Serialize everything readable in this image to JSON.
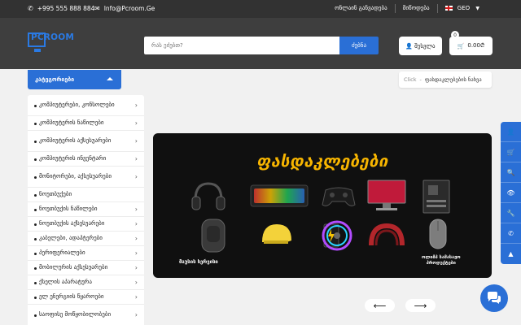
{
  "topbar": {
    "phone": "+995 555 888 884",
    "email": "Info@Pcroom.Ge",
    "links": [
      "ონლაინ განვადება",
      "მიწოდება"
    ],
    "language": "GEO"
  },
  "header": {
    "logo": "PCROOM",
    "search_placeholder": "რას ეძებთ?",
    "search_button": "ძებნა",
    "login_button": "შესვლა",
    "cart_amount": "0.00₾",
    "cart_count": "0"
  },
  "categories": {
    "title": "კატეგორიები",
    "items": [
      "კომპიუტერები, კონსოლები",
      "კომპიუტერის ნაწილები",
      "კომპიუტერის აქსესუარები",
      "კომპიუტერის ინვენტარი",
      "მონიტორები, აქსესუარები",
      "ნოუთბუქები",
      "ნოუთბუქის ნაწილები",
      "ნოუთბუქის აქსესუარები",
      "კაბელები, ადაპტერები",
      "პერიფერიალები",
      "მობილურის აქსესუარები",
      "ქსელის აპარატურა",
      "ელ ენერგიის წყაროები",
      "საოფისე მოწყობილობები"
    ]
  },
  "breadcrumb": {
    "root": "Click",
    "separator": "-",
    "current": "ფასდაკლებების ნახვა"
  },
  "banner": {
    "title": "ფასდაკლებები",
    "caption_left": "მაუსის სერვისი",
    "caption_right_line1": "ოლიმპ სამასაჟო",
    "caption_right_line2": "პროდუქტები"
  },
  "slider": {
    "prev_icon": "arrow-left-icon",
    "next_icon": "arrow-right-icon"
  },
  "dock": [
    "user-icon",
    "cart-icon",
    "search-icon",
    "eye-icon",
    "wrench-icon",
    "phone-icon",
    "arrow-up-icon"
  ],
  "colors": {
    "accent": "#2a6fd6",
    "header_bg": "#3e3e3e",
    "topbar_bg": "#323232",
    "banner_title": "#f7b500"
  }
}
